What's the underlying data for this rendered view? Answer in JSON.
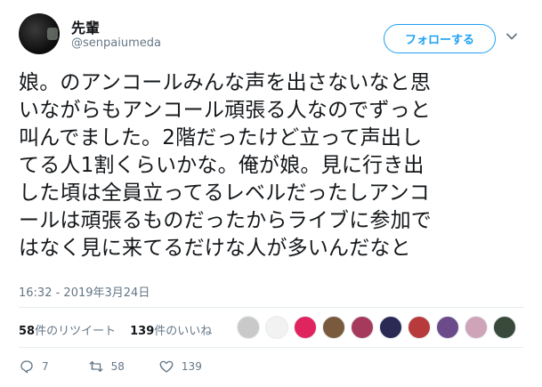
{
  "author": {
    "display_name": "先輩",
    "handle": "@senpaiumeda"
  },
  "follow_button": {
    "label": "フォローする"
  },
  "tweet": {
    "lines": [
      "娘。のアンコールみんな声を出さないなと思",
      "いながらもアンコール頑張る人なのでずっと",
      "叫んでました。2階だったけど立って声出し",
      "てる人1割くらいかな。俺が娘。見に行き出",
      "した頃は全員立ってるレベルだったしアンコ",
      "ールは頑張るものだったからライブに参加で",
      "はなく見に来てるだけな人が多いんだなと"
    ],
    "timestamp": "16:32 - 2019年3月24日"
  },
  "stats": {
    "retweets_count": "58",
    "retweets_label": "件のリツイート",
    "likes_count": "139",
    "likes_label": "件のいいね"
  },
  "liker_avatars": [
    {
      "color": "#c9c9c9"
    },
    {
      "color": "#f2f2f2"
    },
    {
      "color": "#e0245e"
    },
    {
      "color": "#7a5a3c"
    },
    {
      "color": "#a63a5c"
    },
    {
      "color": "#2a2a55"
    },
    {
      "color": "#b83b3b"
    },
    {
      "color": "#6b4b8a"
    },
    {
      "color": "#cfa3b8"
    },
    {
      "color": "#3a4a3a"
    }
  ],
  "actions": {
    "reply_count": "7",
    "retweet_count": "58",
    "like_count": "139"
  },
  "colors": {
    "accent": "#1da1f2",
    "text": "#14171a",
    "secondary": "#657786",
    "divider": "#e6ecf0"
  }
}
